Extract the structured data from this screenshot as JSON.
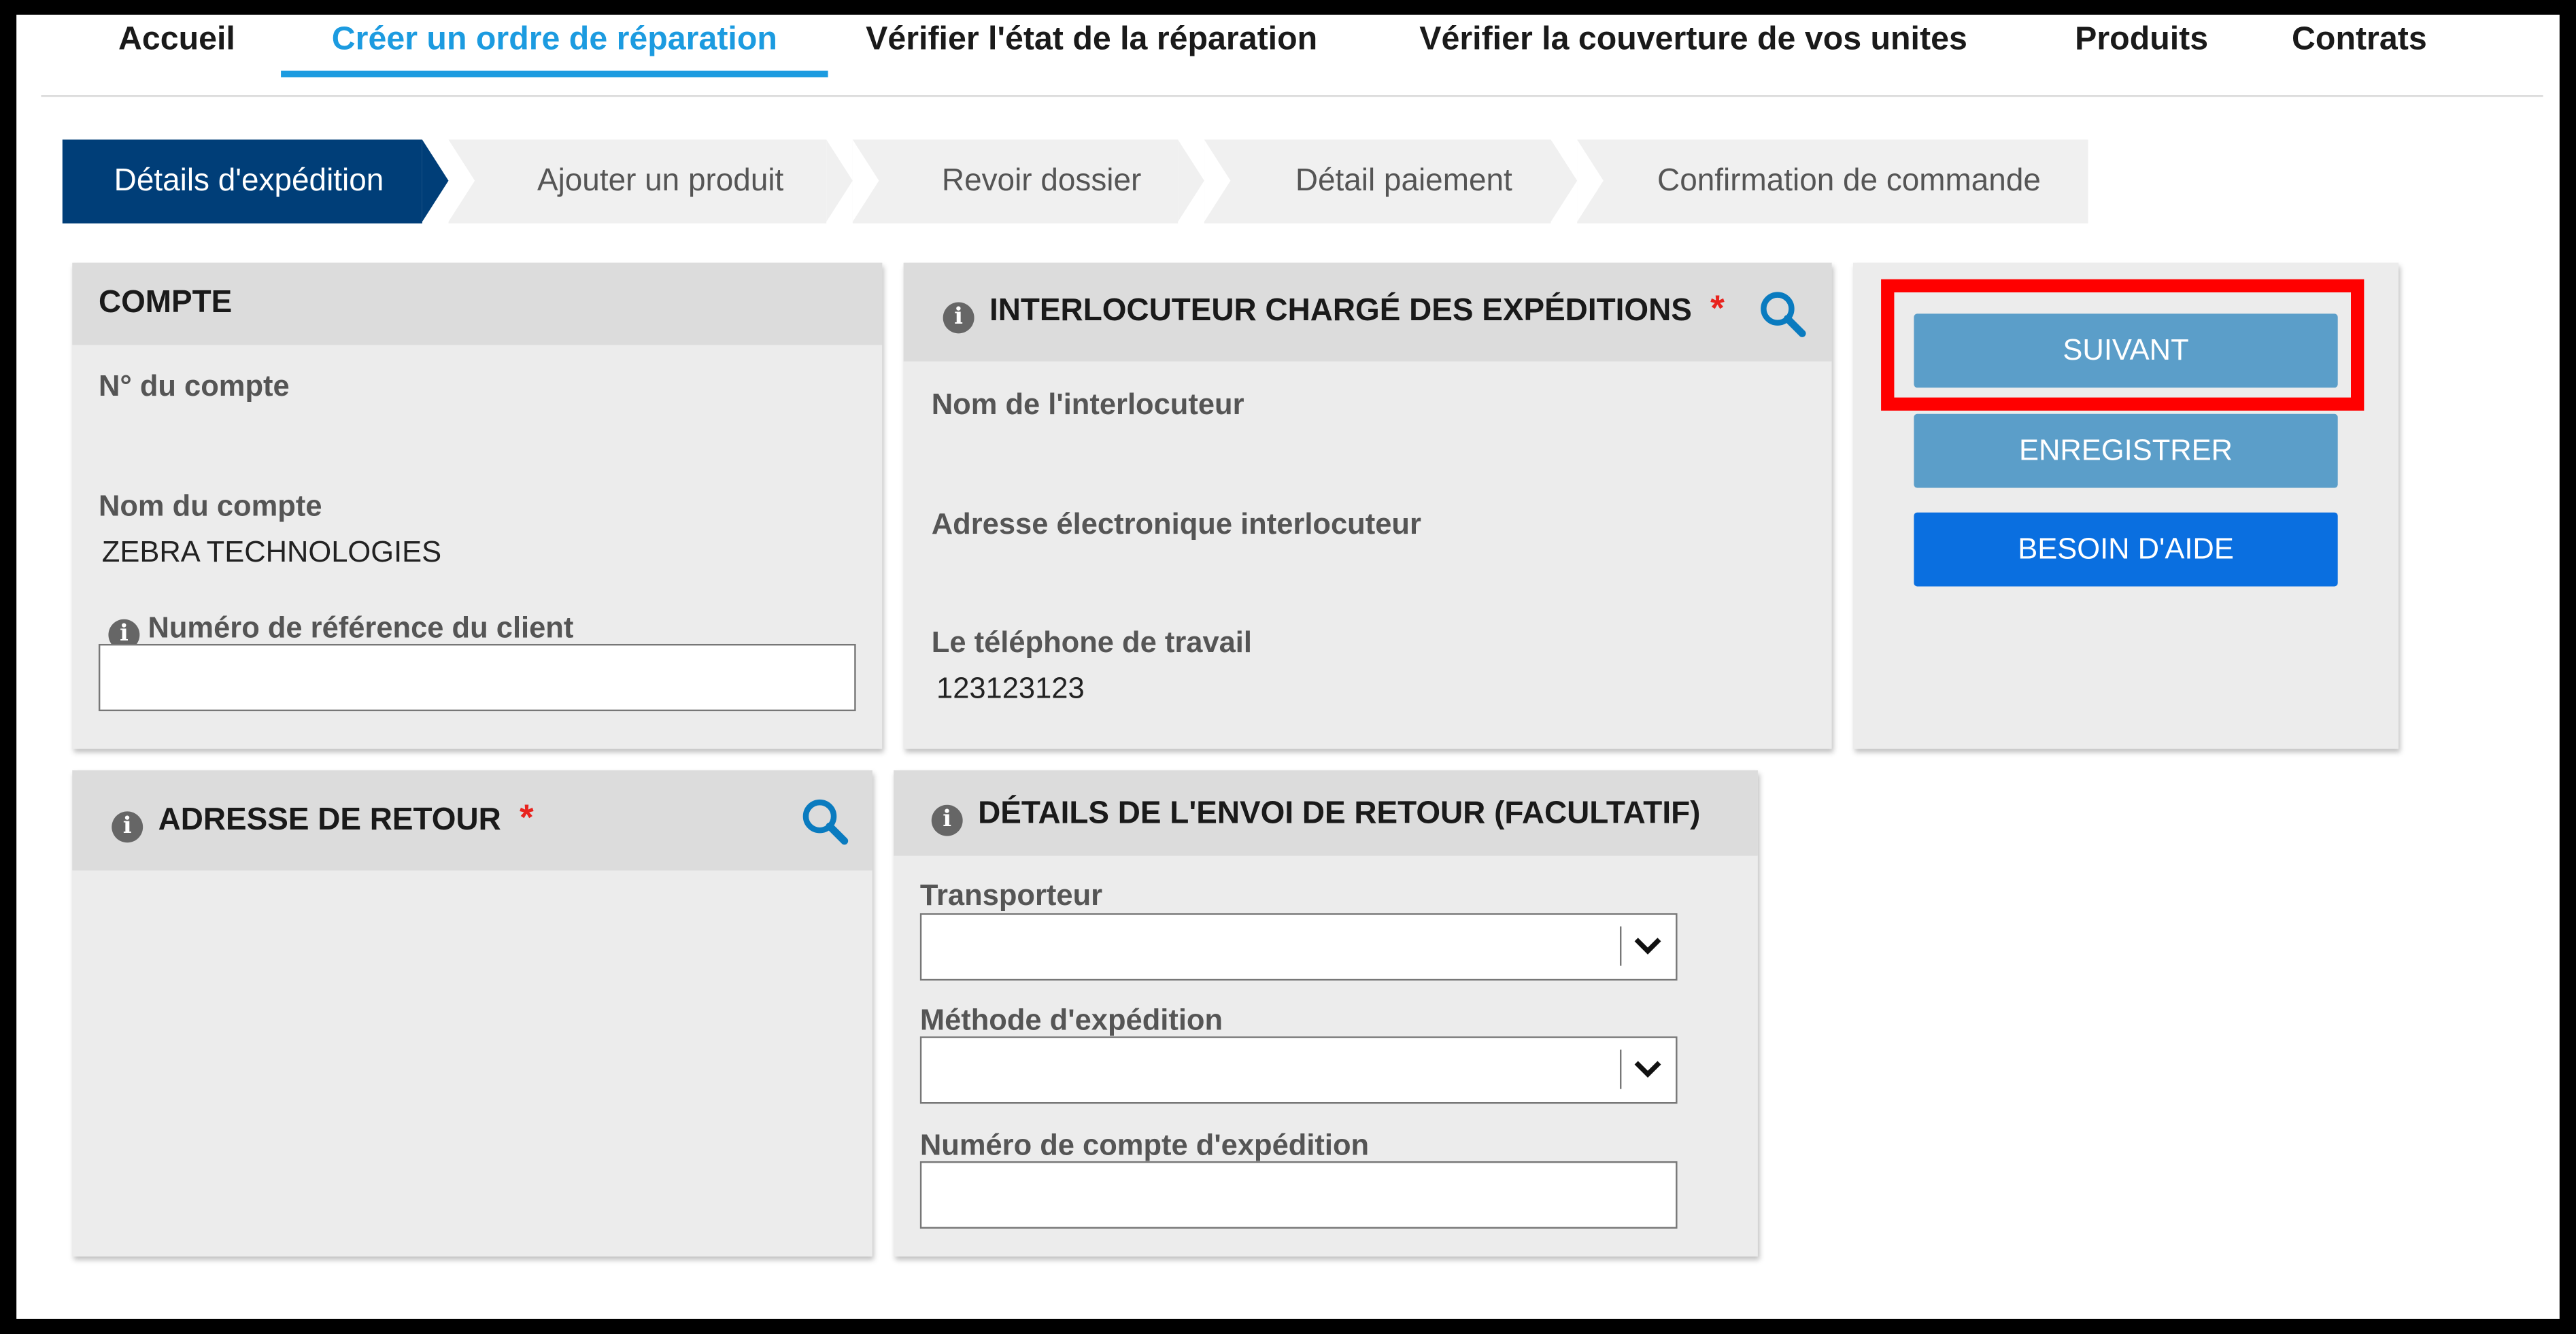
{
  "nav": {
    "items": [
      {
        "label": "Accueil"
      },
      {
        "label": "Créer un ordre de réparation"
      },
      {
        "label": "Vérifier l'état de la réparation"
      },
      {
        "label": "Vérifier la couverture de vos unites"
      },
      {
        "label": "Produits"
      },
      {
        "label": "Contrats"
      }
    ],
    "active_index": 1
  },
  "steps": [
    {
      "label": "Détails d'expédition",
      "active": true
    },
    {
      "label": "Ajouter un produit",
      "active": false
    },
    {
      "label": "Revoir dossier",
      "active": false
    },
    {
      "label": "Détail paiement",
      "active": false
    },
    {
      "label": "Confirmation de commande",
      "active": false
    }
  ],
  "compte": {
    "title": "COMPTE",
    "account_number_label": "N° du compte",
    "account_number_value": "",
    "account_name_label": "Nom du compte",
    "account_name_value": "ZEBRA TECHNOLOGIES",
    "reference_label": "Numéro de référence du client",
    "reference_value": ""
  },
  "interlocuteur": {
    "title": "INTERLOCUTEUR CHARGÉ DES EXPÉDITIONS",
    "required_mark": "*",
    "contact_name_label": "Nom de l'interlocuteur",
    "contact_email_label": "Adresse électronique interlocuteur",
    "work_phone_label": "Le téléphone de travail",
    "work_phone_value": "123123123"
  },
  "actions": {
    "next_label": "SUIVANT",
    "save_label": "ENREGISTRER",
    "help_label": "BESOIN D'AIDE"
  },
  "adresse_retour": {
    "title": "ADRESSE DE RETOUR",
    "required_mark": "*"
  },
  "envoi_retour": {
    "title": "DÉTAILS DE L'ENVOI DE RETOUR (FACULTATIF)",
    "carrier_label": "Transporteur",
    "carrier_value": "",
    "method_label": "Méthode d'expédition",
    "method_value": "",
    "account_label": "Numéro de compte d'expédition",
    "account_value": ""
  },
  "icons": {
    "info": "info-icon",
    "search": "search-icon",
    "dropdown": "chevron-down-icon"
  },
  "colors": {
    "nav_active": "#1c9be0",
    "step_active": "#003e78",
    "btn_next": "#5b9ec9",
    "btn_save": "#5b9ec9",
    "btn_help": "#0a6fe0",
    "required": "#e8231e",
    "search_icon": "#0a7bbf",
    "highlight": "#ff0000"
  }
}
